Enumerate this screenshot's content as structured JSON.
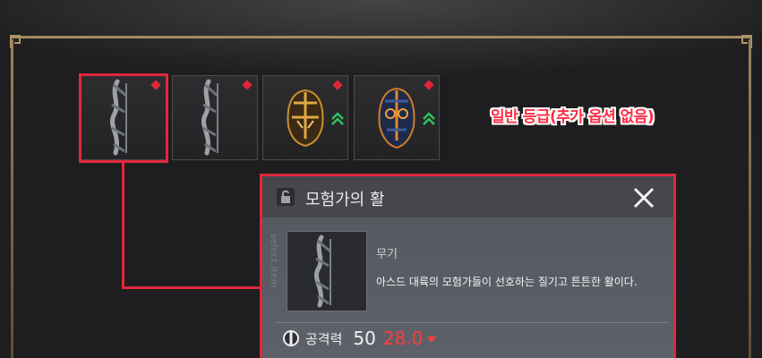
{
  "inventory": {
    "slots": [
      {
        "item": "bow",
        "grade_gem": "red-diamond",
        "upgrade_indicator": false,
        "selected": true
      },
      {
        "item": "bow",
        "grade_gem": "red-diamond",
        "upgrade_indicator": false,
        "selected": false
      },
      {
        "item": "gold-helmet",
        "grade_gem": "red-diamond",
        "upgrade_indicator": true,
        "selected": false
      },
      {
        "item": "blue-helmet",
        "grade_gem": "red-diamond",
        "upgrade_indicator": true,
        "selected": false
      }
    ]
  },
  "annotation": {
    "text": "일반 등급(추가 옵션 없음)",
    "color": "#ff2d45"
  },
  "tooltip": {
    "title": "모험가의 활",
    "side_label": "select item",
    "category": "무기",
    "description": "아스드 대륙의 모험가들이 선호하는 질기고 튼튼한 활이다.",
    "stat": {
      "icon": "attack-icon",
      "label": "공격력",
      "base_value": "50",
      "diff_value": "28.0",
      "diff_direction": "down"
    }
  },
  "colors": {
    "highlight": "#e0283c",
    "gem": "#e0263a",
    "upgrade": "#2fc25a",
    "diff_negative": "#ff3d3d"
  }
}
